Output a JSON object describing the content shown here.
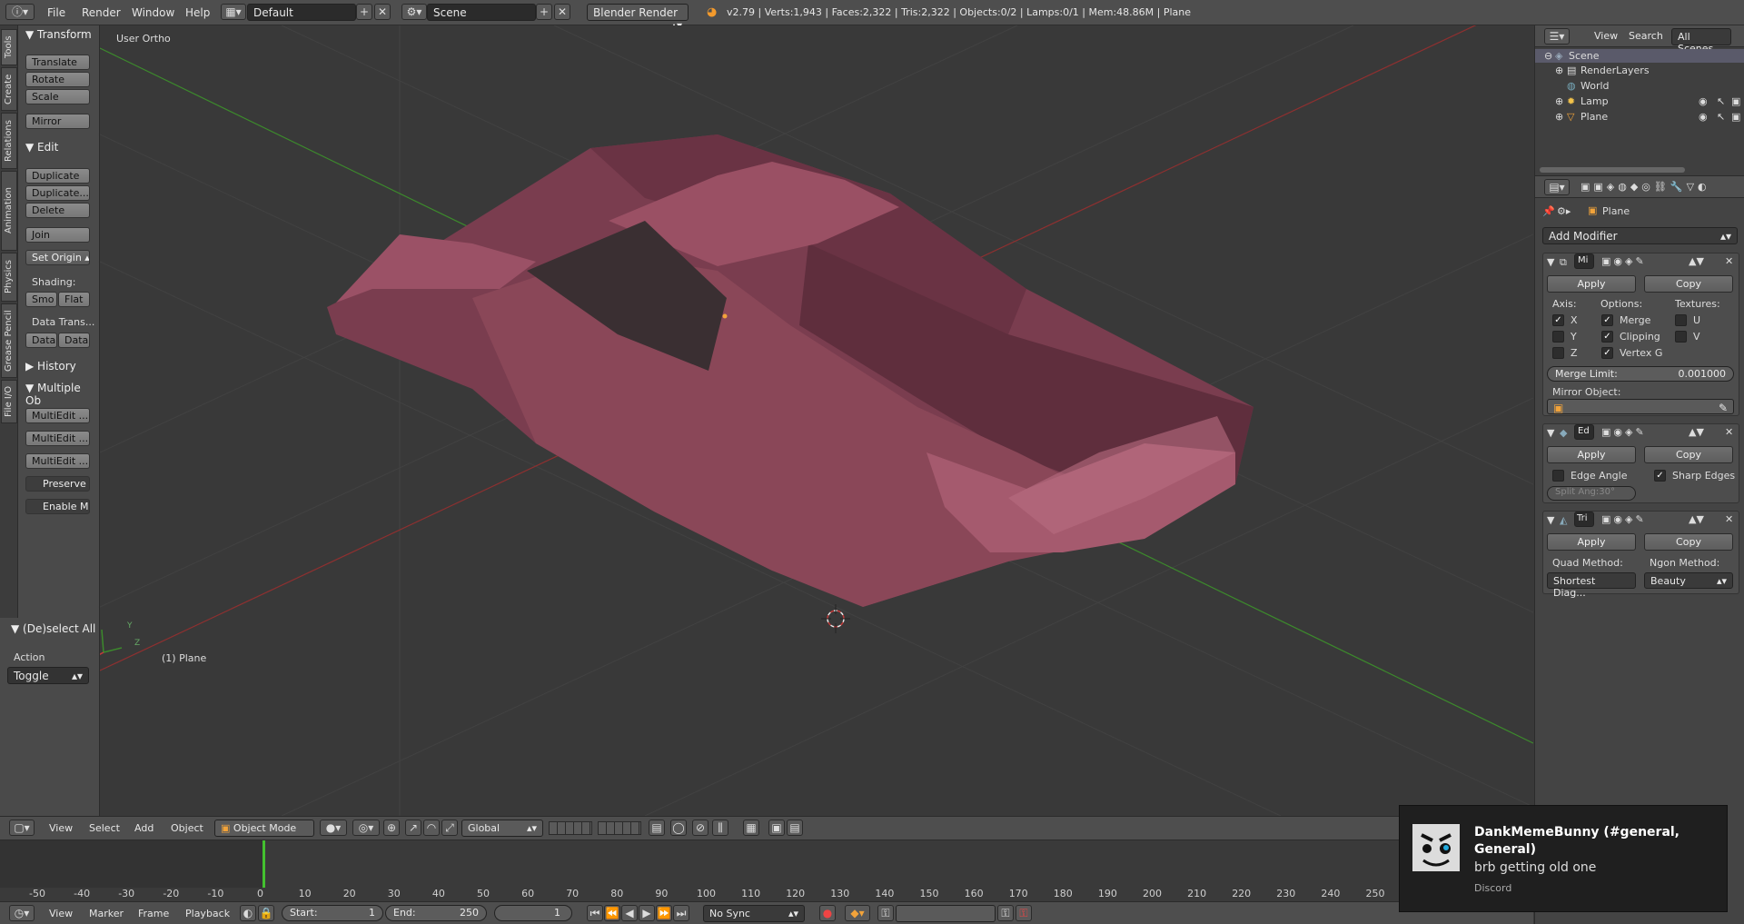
{
  "topbar": {
    "menus": [
      "File",
      "Render",
      "Window",
      "Help"
    ],
    "layout": "Default",
    "scene": "Scene",
    "engine": "Blender Render",
    "stats": "v2.79 | Verts:1,943 | Faces:2,322 | Tris:2,322 | Objects:0/2 | Lamps:0/1 | Mem:48.86M | Plane"
  },
  "tabs": [
    "Tools",
    "Create",
    "Relations",
    "Animation",
    "Physics",
    "Grease Pencil",
    "File I/O"
  ],
  "toolshelf": {
    "transform_head": "Transform",
    "translate": "Translate",
    "rotate": "Rotate",
    "scale": "Scale",
    "mirror": "Mirror",
    "edit_head": "Edit",
    "duplicate": "Duplicate",
    "duplicate_linked": "Duplicate...",
    "delete": "Delete",
    "join": "Join",
    "set_origin": "Set Origin",
    "shading_label": "Shading:",
    "smooth": "Smo",
    "flat": "Flat",
    "data_transfer_label": "Data Trans...",
    "data1": "Data",
    "data2": "Data",
    "history_head": "History",
    "multiple_head": "Multiple Ob",
    "multiedit1": "MultiEdit ...",
    "multiedit2": "MultiEdit ...",
    "multiedit3": "MultiEdit ...",
    "preserve": "Preserve L",
    "enable": "Enable Mu",
    "deselect_head": "(De)select All",
    "action_label": "Action",
    "action_value": "Toggle"
  },
  "viewport": {
    "view_label": "User Ortho",
    "object_label": "(1) Plane"
  },
  "outliner": {
    "header_view": "View",
    "header_search": "Search",
    "header_filter": "All Scenes",
    "items": [
      "Scene",
      "RenderLayers",
      "World",
      "Lamp",
      "Plane"
    ]
  },
  "properties": {
    "object_name": "Plane",
    "add_modifier": "Add Modifier",
    "mirror": {
      "name": "Mi",
      "apply": "Apply",
      "copy": "Copy",
      "axis_label": "Axis:",
      "options_label": "Options:",
      "textures_label": "Textures:",
      "x": "X",
      "y": "Y",
      "z": "Z",
      "merge": "Merge",
      "clipping": "Clipping",
      "vertex_g": "Vertex G",
      "u": "U",
      "v": "V",
      "merge_limit_label": "Merge Limit:",
      "merge_limit_value": "0.001000",
      "mirror_object_label": "Mirror Object:"
    },
    "edge_split": {
      "name": "Ed",
      "apply": "Apply",
      "copy": "Copy",
      "edge_angle": "Edge Angle",
      "sharp_edges": "Sharp Edges",
      "split_angle": "Split Ang:30°"
    },
    "triangulate": {
      "name": "Tri",
      "apply": "Apply",
      "copy": "Copy",
      "quad_label": "Quad Method:",
      "ngon_label": "Ngon Method:",
      "quad_value": "Shortest Diag...",
      "ngon_value": "Beauty"
    }
  },
  "vp_header": {
    "view": "View",
    "select": "Select",
    "add": "Add",
    "object": "Object",
    "mode": "Object Mode",
    "orientation": "Global"
  },
  "timeline": {
    "ticks": [
      "-50",
      "-40",
      "-30",
      "-20",
      "-10",
      "0",
      "10",
      "20",
      "30",
      "40",
      "50",
      "60",
      "70",
      "80",
      "90",
      "100",
      "110",
      "120",
      "130",
      "140",
      "150",
      "160",
      "170",
      "180",
      "190",
      "200",
      "210",
      "220",
      "230",
      "240",
      "250"
    ],
    "view": "View",
    "marker": "Marker",
    "frame": "Frame",
    "playback": "Playback",
    "start_label": "Start:",
    "start_value": "1",
    "end_label": "End:",
    "end_value": "250",
    "current": "1",
    "sync": "No Sync"
  },
  "toast": {
    "title": "DankMemeBunny (#general, General)",
    "message": "brb getting old one",
    "source": "Discord"
  },
  "colors": {
    "mesh": "#8a4758",
    "mesh_light": "#b86c80",
    "x_axis": "#8e3030",
    "y_axis": "#3c8a2c"
  }
}
